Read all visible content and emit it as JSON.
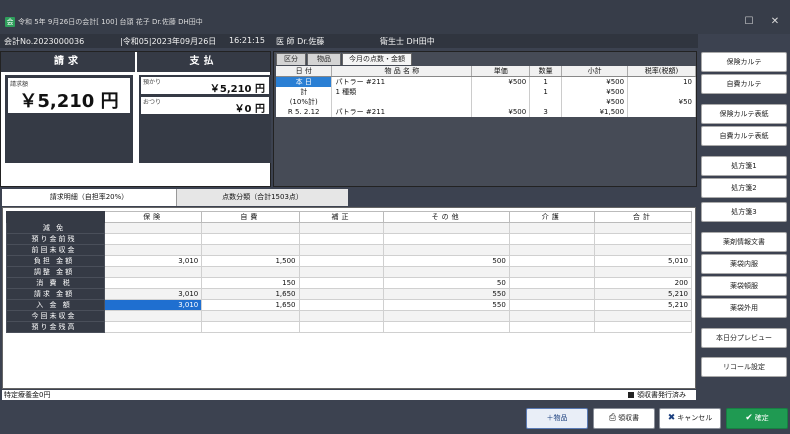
{
  "window": {
    "title": "令和 5年 9月26日の会計[  100] 台頭  花子  Dr.佐藤  DH田中",
    "app_icon": "会"
  },
  "info": {
    "account_no": "会計No.2023000036",
    "date": "|令和05|2023年09月26日",
    "time": "16:21:15",
    "doctor": "医  師 Dr.佐藤",
    "hygienist": "衛生士 DH田中"
  },
  "claim": {
    "header": "請求",
    "label": "請求額",
    "amount": "￥5,210 円"
  },
  "payment": {
    "header": "支払",
    "received_label": "預かり",
    "received": "￥5,210 円",
    "change_label": "おつり",
    "change": "￥0 円"
  },
  "items": {
    "tabs": [
      "区分",
      "物品",
      "今月の点数・金額"
    ],
    "headers": [
      "日  付",
      "物  品  名  称",
      "単価",
      "数量",
      "小計",
      "税率(税額)"
    ],
    "rows": [
      [
        "本  日",
        "パトラー  #211",
        "¥500",
        "1",
        "¥500",
        "10"
      ],
      [
        "計",
        "1 種類",
        "",
        "1",
        "¥500",
        ""
      ],
      [
        "(10%計)",
        "",
        "",
        "",
        "¥500",
        "¥50"
      ],
      [
        "R 5. 2.12",
        "パトラー  #211",
        "¥500",
        "3",
        "¥1,500",
        ""
      ]
    ]
  },
  "side_buttons": [
    "保険カルテ",
    "自費カルテ",
    "保険カルテ表紙",
    "自費カルテ表紙",
    "処方箋1",
    "処方箋2",
    "処方箋3",
    "薬剤情報文書",
    "薬袋内服",
    "薬袋頓服",
    "薬袋外用",
    "本日分プレビュー",
    "リコール設定"
  ],
  "detail": {
    "tab_active": "請求明細（自担率20%）",
    "tab_inactive": "点数分類（合計1503点）",
    "columns": [
      "保険",
      "自費",
      "補正",
      "その他",
      "介護",
      "合計"
    ],
    "rows": [
      {
        "label": "減  免",
        "cells": [
          "",
          "",
          "",
          "",
          "",
          ""
        ]
      },
      {
        "label": "預り金前残",
        "cells": [
          "",
          "",
          "",
          "",
          "",
          ""
        ]
      },
      {
        "label": "前回未収金",
        "cells": [
          "",
          "",
          "",
          "",
          "",
          ""
        ]
      },
      {
        "label": "負担 金額",
        "cells": [
          "3,010",
          "1,500",
          "",
          "500",
          "",
          "5,010"
        ]
      },
      {
        "label": "調整 金額",
        "cells": [
          "",
          "",
          "",
          "",
          "",
          ""
        ]
      },
      {
        "label": "消 費 税",
        "cells": [
          "",
          "150",
          "",
          "50",
          "",
          "200"
        ]
      },
      {
        "label": "請求 金額",
        "cells": [
          "3,010",
          "1,650",
          "",
          "550",
          "",
          "5,210"
        ]
      },
      {
        "label": "入 金 額",
        "cells": [
          "3,010",
          "1,650",
          "",
          "550",
          "",
          "5,210"
        ]
      },
      {
        "label": "今回未収金",
        "cells": [
          "",
          "",
          "",
          "",
          "",
          ""
        ]
      },
      {
        "label": "預り金残高",
        "cells": [
          "",
          "",
          "",
          "",
          "",
          ""
        ]
      }
    ]
  },
  "status": {
    "left": "特定療養金0円",
    "right": "領収書発行済み"
  },
  "footer": {
    "item_button": "＋物品",
    "receipt_button": "領収書",
    "cancel_button": "キャンセル",
    "confirm_button": "確定"
  }
}
